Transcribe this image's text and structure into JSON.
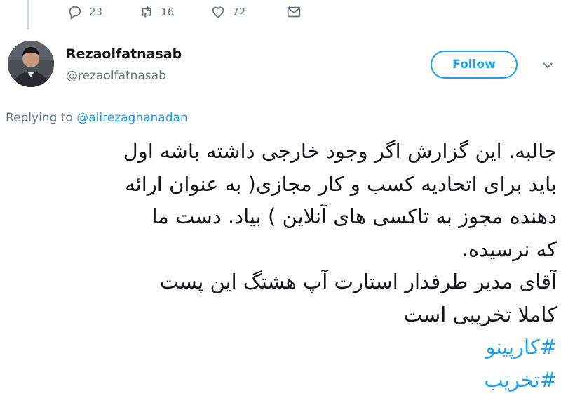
{
  "actions": {
    "reply_count": "23",
    "retweet_count": "16",
    "like_count": "72"
  },
  "user": {
    "display_name": "Rezaolfatnasab",
    "handle": "@rezaolfatnasab"
  },
  "follow_label": "Follow",
  "replying": {
    "prefix": "Replying to ",
    "mention": "@alirezaghanadan"
  },
  "tweet": {
    "lines": [
      "جالبه. این گزارش اگر وجود خارجی داشته باشه اول",
      "باید برای اتحادیه کسب و کار مجازی( به عنوان ارائه",
      "دهنده مجوز به تاکسی های آنلاین ) بیاد. دست ما",
      "که نرسیده.",
      "آقای مدیر طرفدار استارت آپ هشتگ این پست",
      "کاملا تخریبی است"
    ],
    "hashtags": [
      "#کارپینو",
      "#تخریب"
    ]
  }
}
